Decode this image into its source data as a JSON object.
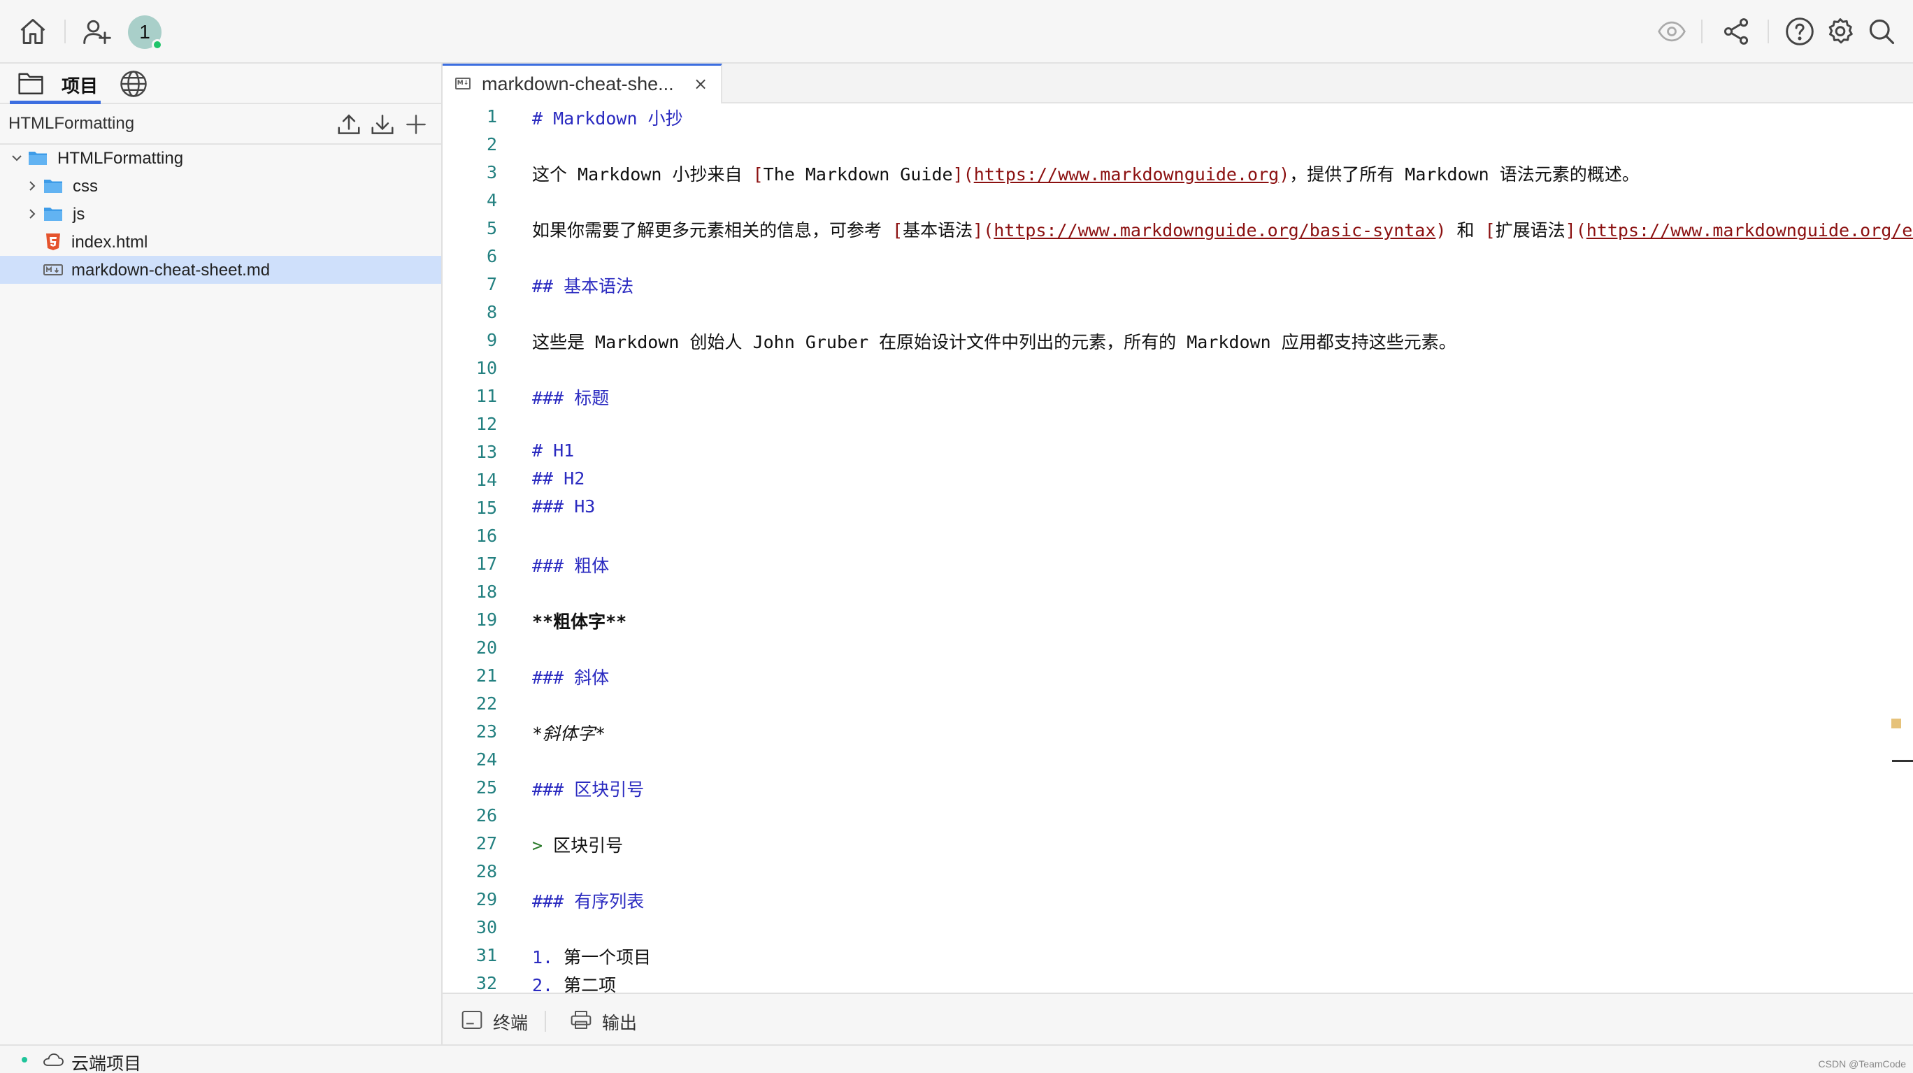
{
  "sidebar": {
    "tab_files_label": "项目",
    "header_title": "HTMLFormatting",
    "tree": [
      {
        "name": "HTMLFormatting",
        "kind": "root-folder"
      },
      {
        "name": "css",
        "kind": "folder"
      },
      {
        "name": "js",
        "kind": "folder"
      },
      {
        "name": "index.html",
        "kind": "html"
      },
      {
        "name": "markdown-cheat-sheet.md",
        "kind": "md"
      }
    ]
  },
  "avatar": {
    "text": "1"
  },
  "editor_tab": {
    "label": "markdown-cheat-she...",
    "close": "×",
    "badge": "M↓"
  },
  "editor": {
    "lines": [
      {
        "n": "1",
        "s": [
          [
            "c-head",
            "# Markdown 小抄"
          ]
        ]
      },
      {
        "n": "2",
        "s": []
      },
      {
        "n": "3",
        "s": [
          [
            "",
            "这个 Markdown 小抄来自 "
          ],
          [
            "c-bracket",
            "["
          ],
          [
            "",
            "The Markdown Guide"
          ],
          [
            "c-bracket",
            "]("
          ],
          [
            "c-url",
            "https://www.markdownguide.org"
          ],
          [
            "c-bracket",
            ")"
          ],
          [
            "",
            "，提供了所有 Markdown 语法元素的概述。"
          ]
        ]
      },
      {
        "n": "4",
        "s": []
      },
      {
        "n": "5",
        "s": [
          [
            "",
            "如果你需要了解更多元素相关的信息，可参考 "
          ],
          [
            "c-bracket",
            "["
          ],
          [
            "",
            "基本语法"
          ],
          [
            "c-bracket",
            "]("
          ],
          [
            "c-url",
            "https://www.markdownguide.org/basic-syntax"
          ],
          [
            "c-bracket",
            ")"
          ],
          [
            "",
            " 和 "
          ],
          [
            "c-bracket",
            "["
          ],
          [
            "",
            "扩展语法"
          ],
          [
            "c-bracket",
            "]("
          ],
          [
            "c-url",
            "https://www.markdownguide.org/extended-syntax"
          ]
        ]
      },
      {
        "n": "6",
        "s": []
      },
      {
        "n": "7",
        "s": [
          [
            "c-head",
            "## 基本语法"
          ]
        ]
      },
      {
        "n": "8",
        "s": []
      },
      {
        "n": "9",
        "s": [
          [
            "",
            "这些是 Markdown 创始人 John Gruber 在原始设计文件中列出的元素，所有的 Markdown 应用都支持这些元素。"
          ]
        ]
      },
      {
        "n": "10",
        "s": []
      },
      {
        "n": "11",
        "s": [
          [
            "c-head",
            "### 标题"
          ]
        ]
      },
      {
        "n": "12",
        "s": []
      },
      {
        "n": "13",
        "s": [
          [
            "c-head",
            "# H1"
          ]
        ]
      },
      {
        "n": "14",
        "s": [
          [
            "c-head",
            "## H2"
          ]
        ]
      },
      {
        "n": "15",
        "s": [
          [
            "c-head",
            "### H3"
          ]
        ]
      },
      {
        "n": "16",
        "s": []
      },
      {
        "n": "17",
        "s": [
          [
            "c-head",
            "### 粗体"
          ]
        ]
      },
      {
        "n": "18",
        "s": []
      },
      {
        "n": "19",
        "s": [
          [
            "c-bold",
            "**粗体字**"
          ]
        ]
      },
      {
        "n": "20",
        "s": []
      },
      {
        "n": "21",
        "s": [
          [
            "c-head",
            "### 斜体"
          ]
        ]
      },
      {
        "n": "22",
        "s": []
      },
      {
        "n": "23",
        "s": [
          [
            "c-italic",
            "*斜体字*"
          ]
        ]
      },
      {
        "n": "24",
        "s": []
      },
      {
        "n": "25",
        "s": [
          [
            "c-head",
            "### 区块引号"
          ]
        ]
      },
      {
        "n": "26",
        "s": []
      },
      {
        "n": "27",
        "s": [
          [
            "c-quote",
            ">"
          ],
          [
            "",
            " 区块引号"
          ]
        ]
      },
      {
        "n": "28",
        "s": []
      },
      {
        "n": "29",
        "s": [
          [
            "c-head",
            "### 有序列表"
          ]
        ]
      },
      {
        "n": "30",
        "s": []
      },
      {
        "n": "31",
        "s": [
          [
            "c-num",
            "1."
          ],
          [
            "",
            " 第一个项目"
          ]
        ]
      },
      {
        "n": "32",
        "s": [
          [
            "c-num",
            "2."
          ],
          [
            "",
            " 第二项"
          ]
        ]
      }
    ]
  },
  "bottom_panel": {
    "terminal_label": "终端",
    "output_label": "输出"
  },
  "statusbar": {
    "cloud_label": "云端项目",
    "watermark": "CSDN @TeamCode"
  },
  "colors": {
    "accent": "#3c6ee0",
    "selection": "#cfe0fb",
    "heading": "#2a2ac0",
    "link": "#8b1010",
    "line_number": "#238080"
  }
}
